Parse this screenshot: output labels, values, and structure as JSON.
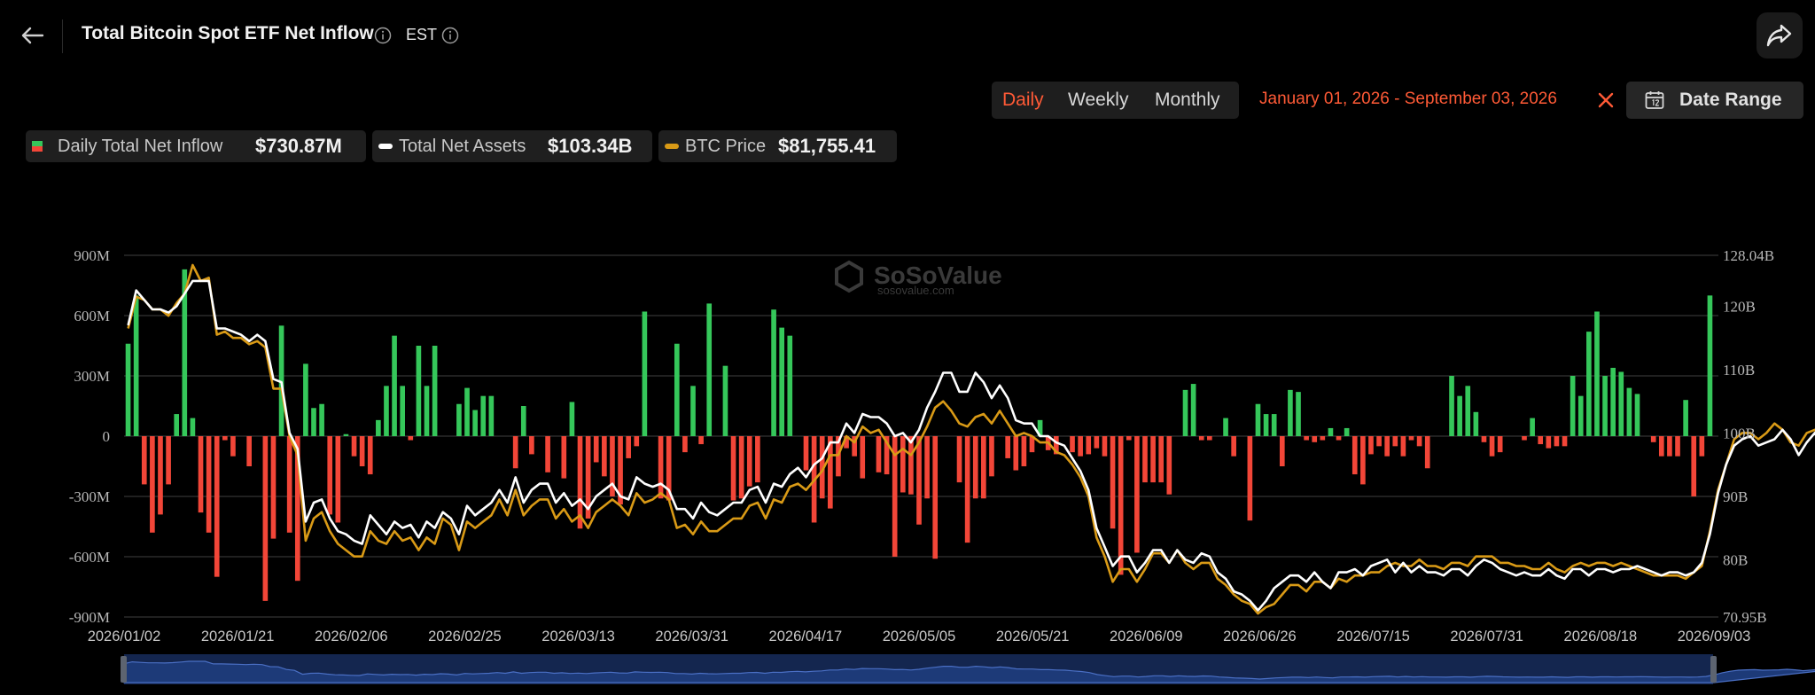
{
  "header": {
    "title": "Total Bitcoin Spot ETF Net Inflow",
    "timezone": "EST"
  },
  "controls": {
    "periods": [
      "Daily",
      "Weekly",
      "Monthly"
    ],
    "active_period": "Daily",
    "date_range_text": "January 01, 2026 - September 03, 2026",
    "date_range_button": "Date Range"
  },
  "legend": [
    {
      "name": "Daily Total Net Inflow",
      "value": "$730.87M"
    },
    {
      "name": "Total Net Assets",
      "value": "$103.34B"
    },
    {
      "name": "BTC Price",
      "value": "$81,755.41"
    }
  ],
  "watermark": {
    "brand": "SoSoValue",
    "site": "sosovalue.com"
  },
  "colors": {
    "positive": "#35c75a",
    "negative": "#f24638",
    "assets_line": "#ffffff",
    "price_line": "#d99a16",
    "accent": "#ff5a36",
    "grid": "#333333",
    "navigator_fill": "#1d3a78"
  },
  "chart_data": {
    "type": "bar",
    "left_axis": {
      "ticks": [
        "900M",
        "600M",
        "300M",
        "0",
        "-300M",
        "-600M",
        "-900M"
      ],
      "ylim": [
        -900,
        900
      ]
    },
    "right_axis": {
      "ticks": [
        "128.04B",
        "120B",
        "110B",
        "100B",
        "90B",
        "80B",
        "70.95B"
      ],
      "ylim": [
        70.95,
        128.04
      ]
    },
    "x_labels": [
      "2026/01/02",
      "2026/01/21",
      "2026/02/06",
      "2026/02/25",
      "2026/03/13",
      "2026/03/31",
      "2026/04/17",
      "2026/05/05",
      "2026/05/21",
      "2026/06/09",
      "2026/06/26",
      "2026/07/15",
      "2026/07/31",
      "2026/08/18",
      "2026/09/03"
    ],
    "series": [
      {
        "name": "Daily Total Net Inflow",
        "unit": "M USD",
        "values": [
          460,
          700,
          -240,
          -480,
          -390,
          -240,
          110,
          830,
          90,
          -380,
          -480,
          -700,
          -20,
          -100,
          0,
          -150,
          0,
          -820,
          -510,
          550,
          -480,
          -720,
          360,
          140,
          160,
          -390,
          -430,
          10,
          -100,
          -150,
          -190,
          80,
          250,
          500,
          250,
          -20,
          450,
          250,
          450,
          0,
          0,
          160,
          240,
          130,
          200,
          200,
          0,
          0,
          -160,
          150,
          -90,
          0,
          -180,
          0,
          -210,
          170,
          -460,
          -410,
          -130,
          -200,
          -300,
          -340,
          -110,
          -50,
          620,
          0,
          -310,
          -320,
          460,
          -80,
          250,
          -40,
          660,
          0,
          350,
          -320,
          -310,
          -250,
          -230,
          0,
          630,
          540,
          500,
          0,
          -170,
          -430,
          -310,
          -360,
          -200,
          -60,
          -100,
          -210,
          0,
          -180,
          -190,
          -600,
          -280,
          -290,
          -440,
          -310,
          -610,
          0,
          0,
          -230,
          -530,
          -310,
          -310,
          -200,
          0,
          -110,
          -170,
          -150,
          -80,
          80,
          -70,
          -90,
          0,
          -80,
          -100,
          -90,
          -60,
          -100,
          -460,
          -690,
          -20,
          -580,
          -230,
          -230,
          -230,
          -290,
          0,
          230,
          260,
          -20,
          -20,
          0,
          90,
          -100,
          0,
          -420,
          160,
          110,
          110,
          -150,
          230,
          220,
          -20,
          -30,
          -20,
          40,
          -20,
          40,
          -190,
          -240,
          -90,
          -50,
          -100,
          -50,
          -100,
          -20,
          -50,
          -160,
          0,
          0,
          300,
          200,
          250,
          120,
          -30,
          -100,
          -80,
          0,
          0,
          -20,
          90,
          -40,
          -60,
          -50,
          -50,
          300,
          200,
          520,
          620,
          300,
          340,
          320,
          240,
          210,
          0,
          -30,
          -100,
          -100,
          -100,
          180,
          -300,
          -100,
          700
        ]
      },
      {
        "name": "Total Net Assets",
        "unit": "B USD",
        "values": [
          117.0,
          122.5,
          121.0,
          119.5,
          119.5,
          119.0,
          120.0,
          122.0,
          124.0,
          124.0,
          124.0,
          116.5,
          116.5,
          116.0,
          115.5,
          114.5,
          115.5,
          114.5,
          108.5,
          108.0,
          100.0,
          97.5,
          86.0,
          89.0,
          89.5,
          86.5,
          84.5,
          84.0,
          83.0,
          82.5,
          87.0,
          85.5,
          84.0,
          86.0,
          85.0,
          85.5,
          83.5,
          86.0,
          85.0,
          87.5,
          86.5,
          84.0,
          88.5,
          87.0,
          88.0,
          89.0,
          91.0,
          89.0,
          93.0,
          89.0,
          91.0,
          92.0,
          92.0,
          89.0,
          90.5,
          88.5,
          89.5,
          88.0,
          90.0,
          91.0,
          92.0,
          90.0,
          89.5,
          93.0,
          92.0,
          91.5,
          92.0,
          91.0,
          88.0,
          88.0,
          86.5,
          89.0,
          87.5,
          87.0,
          88.0,
          89.0,
          89.0,
          91.0,
          91.5,
          89.0,
          92.0,
          91.5,
          93.5,
          94.5,
          93.0,
          95.0,
          96.0,
          98.5,
          98.5,
          101.5,
          100.0,
          103.0,
          102.5,
          102.5,
          101.5,
          99.5,
          100.0,
          98.5,
          100.5,
          104.0,
          106.5,
          109.5,
          109.5,
          106.5,
          106.5,
          109.5,
          108.0,
          105.5,
          107.5,
          105.5,
          102.0,
          101.5,
          101.5,
          99.5,
          99.5,
          98.5,
          98.0,
          96.0,
          94.0,
          91.0,
          85.0,
          82.0,
          79.0,
          80.5,
          80.5,
          78.0,
          79.5,
          81.5,
          81.5,
          79.5,
          81.5,
          80.0,
          79.5,
          81.0,
          80.5,
          78.0,
          77.0,
          75.0,
          74.5,
          73.5,
          72.0,
          73.5,
          75.5,
          76.5,
          77.5,
          77.5,
          76.5,
          78.0,
          76.5,
          75.5,
          78.0,
          78.0,
          78.5,
          77.5,
          79.0,
          79.5,
          80.0,
          78.0,
          79.5,
          78.0,
          79.0,
          78.0,
          78.0,
          77.5,
          78.5,
          78.5,
          77.5,
          79.0,
          80.0,
          79.5,
          78.5,
          78.0,
          77.5,
          78.0,
          77.5,
          77.5,
          78.5,
          77.5,
          77.0,
          78.5,
          78.5,
          77.5,
          78.5,
          78.5,
          78.0,
          78.5,
          78.5,
          79.0,
          78.5,
          78.0,
          77.5,
          78.0,
          78.0,
          77.5,
          78.0,
          79.5,
          84.0,
          90.5,
          95.0,
          98.0,
          99.0,
          99.5,
          98.0,
          98.5,
          99.0,
          100.5,
          99.0,
          96.5,
          98.5,
          100.0,
          97.5,
          99.5,
          103.34
        ]
      },
      {
        "name": "BTC Price",
        "unit": "B-scale (right axis)",
        "values": [
          116.5,
          121.5,
          121.0,
          119.5,
          119.5,
          118.5,
          120.5,
          122.0,
          126.5,
          124.0,
          124.5,
          115.5,
          116.0,
          115.0,
          115.0,
          114.0,
          114.5,
          113.5,
          107.0,
          107.0,
          99.5,
          96.5,
          83.0,
          86.5,
          87.5,
          84.5,
          82.5,
          81.5,
          80.5,
          80.5,
          84.5,
          83.0,
          82.5,
          84.5,
          83.0,
          83.5,
          81.5,
          83.5,
          82.5,
          86.5,
          85.5,
          81.5,
          86.0,
          85.0,
          86.0,
          87.0,
          89.5,
          87.0,
          91.0,
          87.0,
          88.5,
          89.5,
          89.5,
          86.5,
          88.0,
          86.0,
          87.0,
          85.0,
          87.5,
          88.5,
          89.5,
          88.5,
          87.0,
          90.5,
          89.0,
          89.5,
          90.5,
          89.5,
          85.0,
          85.5,
          84.0,
          86.0,
          84.5,
          84.5,
          85.5,
          86.5,
          86.5,
          88.5,
          89.0,
          86.5,
          89.5,
          89.0,
          91.5,
          92.0,
          91.0,
          92.5,
          94.0,
          96.5,
          96.5,
          99.5,
          98.5,
          101.0,
          100.0,
          100.5,
          98.5,
          96.5,
          97.5,
          96.5,
          98.5,
          101.0,
          104.0,
          105.0,
          103.5,
          101.5,
          101.0,
          102.5,
          103.0,
          101.5,
          103.5,
          101.5,
          99.5,
          100.0,
          99.5,
          98.5,
          98.5,
          97.0,
          96.5,
          95.0,
          93.0,
          90.0,
          83.5,
          80.5,
          76.5,
          78.5,
          78.5,
          76.5,
          78.5,
          81.0,
          81.0,
          79.5,
          81.5,
          79.5,
          78.5,
          79.5,
          79.5,
          77.0,
          76.0,
          74.5,
          73.5,
          73.0,
          71.5,
          72.5,
          73.0,
          74.5,
          76.0,
          76.0,
          75.0,
          76.5,
          76.5,
          75.5,
          77.0,
          76.5,
          77.5,
          77.5,
          78.0,
          78.0,
          79.0,
          79.5,
          79.0,
          79.0,
          80.0,
          79.0,
          79.0,
          78.5,
          79.5,
          79.5,
          79.0,
          80.5,
          80.5,
          80.5,
          79.5,
          79.5,
          79.0,
          79.0,
          78.5,
          78.5,
          79.5,
          78.5,
          78.0,
          79.0,
          79.5,
          79.0,
          79.5,
          79.5,
          79.0,
          79.5,
          79.0,
          78.5,
          78.0,
          77.5,
          77.5,
          77.5,
          77.5,
          77.0,
          78.0,
          79.0,
          84.5,
          91.0,
          95.0,
          99.0,
          100.0,
          100.0,
          99.0,
          100.0,
          101.5,
          100.5,
          98.5,
          98.0,
          100.0,
          100.5,
          98.5,
          100.5,
          104.0
        ]
      }
    ]
  }
}
